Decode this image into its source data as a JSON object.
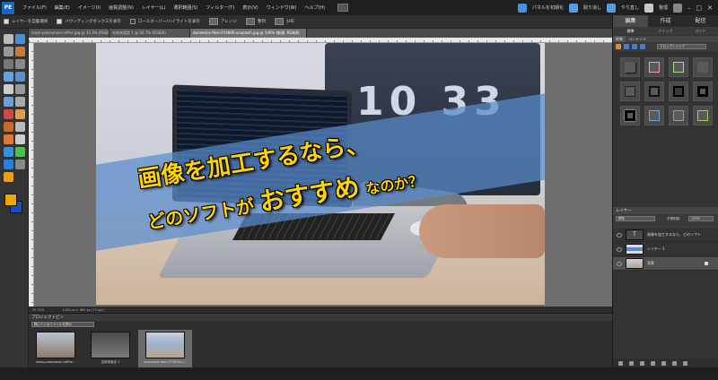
{
  "app": {
    "logo": "PE"
  },
  "menu": [
    "ファイル(F)",
    "編集(E)",
    "イメージ(I)",
    "画質調整(N)",
    "レイヤー(L)",
    "選択範囲(S)",
    "フィルター(T)",
    "表示(V)",
    "ウィンドウ(W)",
    "ヘルプ(H)"
  ],
  "header_right": {
    "panel_label": "パネルを初期化",
    "undo": "取り消し",
    "redo": "やり直し",
    "organizer": "整理"
  },
  "options": {
    "auto_select": "レイヤーを自動選択",
    "bounding_box": "バウンディングボックスを表示",
    "rollover": "ロールオーバー/ハイライトを表示",
    "arrange": "アレンジ",
    "align": "整列",
    "distribute": "分布"
  },
  "doc_tabs": [
    {
      "label": "mass-prossumer-coffee.jpg @ 33.3% (RGB/8)",
      "active": false
    },
    {
      "label": "名称未設定 1 @ 66.7% (RGB/8)",
      "active": false
    },
    {
      "label": "dumenico-fdes-074800-unsplash.jpg @ 100% (新規, RGB/8)",
      "active": true
    }
  ],
  "image": {
    "clock": "10 33",
    "title_line1": "画像を加工するなら、",
    "title_line2_a": "どのソフトが",
    "title_line2_b": "おすすめ",
    "title_line2_c": "なのか？"
  },
  "status": {
    "zoom": "33.33%",
    "size": "1400 px × 960 px (72 ppi)"
  },
  "project_bin": {
    "title": "プロジェクトビン",
    "filter": "開いているファイルを表示",
    "items": [
      {
        "caption": "mass-prossumer-coffee...",
        "active": false
      },
      {
        "caption": "名称未設定 1",
        "active": false
      },
      {
        "caption": "dumenico-fdes-074800-u...",
        "active": true
      }
    ]
  },
  "right_panel": {
    "modes": [
      {
        "label": "編集",
        "active": true
      },
      {
        "label": "作成",
        "active": false
      },
      {
        "label": "配信",
        "active": false
      }
    ],
    "submodes": [
      {
        "label": "標準",
        "active": true
      },
      {
        "label": "クイック",
        "active": false
      },
      {
        "label": "ガイド",
        "active": false
      }
    ],
    "effects_tabs": [
      {
        "label": "効果",
        "active": true
      },
      {
        "label": "コンテンツ",
        "active": false
      }
    ],
    "effects_select": "ドロップシャドウ",
    "layers": {
      "title": "レイヤー",
      "blend_mode": "標準",
      "opacity_label": "不透明度:",
      "opacity": "100%",
      "items": [
        {
          "name": "画像を加工するなら、どのソフト",
          "type": "text"
        },
        {
          "name": "レイヤー 1",
          "type": "band"
        },
        {
          "name": "背景",
          "type": "photo",
          "locked": true
        }
      ]
    }
  }
}
